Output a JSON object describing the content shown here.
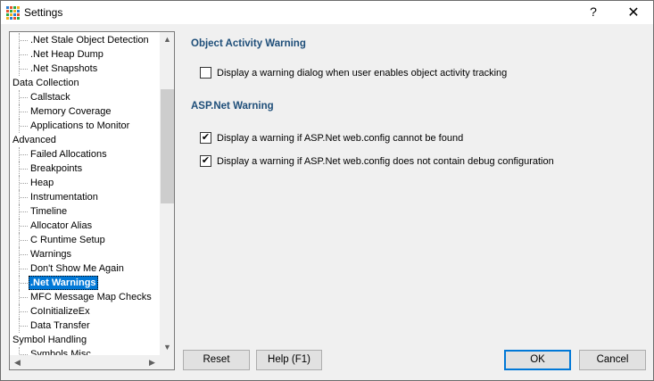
{
  "window": {
    "title": "Settings",
    "help_glyph": "?",
    "close_glyph": "✕"
  },
  "tree": {
    "items": [
      {
        "label": ".Net Stale Object Detection",
        "level": 1
      },
      {
        "label": ".Net Heap Dump",
        "level": 1
      },
      {
        "label": ".Net Snapshots",
        "level": 1
      },
      {
        "label": "Data Collection",
        "level": 0
      },
      {
        "label": "Callstack",
        "level": 1
      },
      {
        "label": "Memory Coverage",
        "level": 1
      },
      {
        "label": "Applications to Monitor",
        "level": 1
      },
      {
        "label": "Advanced",
        "level": 0
      },
      {
        "label": "Failed Allocations",
        "level": 1
      },
      {
        "label": "Breakpoints",
        "level": 1
      },
      {
        "label": "Heap",
        "level": 1
      },
      {
        "label": "Instrumentation",
        "level": 1
      },
      {
        "label": "Timeline",
        "level": 1
      },
      {
        "label": "Allocator Alias",
        "level": 1
      },
      {
        "label": "C Runtime Setup",
        "level": 1
      },
      {
        "label": "Warnings",
        "level": 1
      },
      {
        "label": "Don't Show Me Again",
        "level": 1
      },
      {
        "label": ".Net Warnings",
        "level": 1,
        "selected": true
      },
      {
        "label": "MFC Message Map Checks",
        "level": 1
      },
      {
        "label": "CoInitializeEx",
        "level": 1
      },
      {
        "label": "Data Transfer",
        "level": 1
      },
      {
        "label": "Symbol Handling",
        "level": 0
      },
      {
        "label": "Symbols Misc",
        "level": 1
      }
    ],
    "scroll_up_glyph": "▲",
    "scroll_down_glyph": "▼",
    "scroll_left_glyph": "◀",
    "scroll_right_glyph": "▶"
  },
  "object_activity": {
    "heading": "Object Activity Warning",
    "option": {
      "label": "Display a warning dialog when user enables object activity tracking",
      "checked": false
    }
  },
  "aspnet": {
    "heading": "ASP.Net Warning",
    "options": [
      {
        "label": "Display a warning if ASP.Net web.config cannot be found",
        "checked": true
      },
      {
        "label": "Display a warning if ASP.Net web.config does not contain debug configuration",
        "checked": true
      }
    ]
  },
  "buttons": {
    "reset": "Reset",
    "help": "Help (F1)",
    "ok": "OK",
    "cancel": "Cancel"
  },
  "colors": {
    "accent": "#0078d7",
    "heading": "#1e4e79"
  }
}
